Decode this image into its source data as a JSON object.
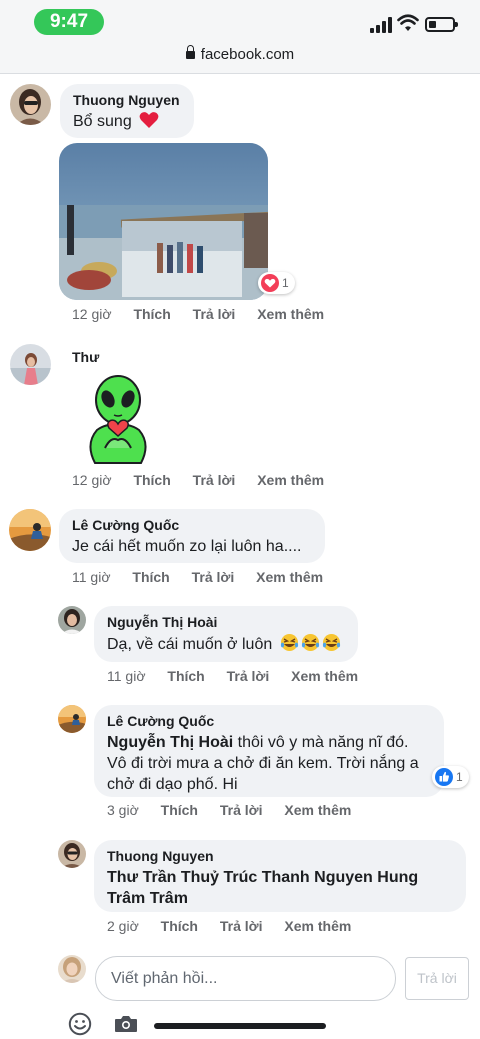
{
  "status": {
    "time": "9:47"
  },
  "browser": {
    "url": "facebook.com"
  },
  "comments": [
    {
      "author": "Thuong Nguyen",
      "text": "Bổ sung",
      "time": "12 giờ",
      "like": "Thích",
      "reply": "Trả lời",
      "more": "Xem thêm",
      "reaction_count": "1"
    },
    {
      "author": "Thư",
      "time": "12 giờ",
      "like": "Thích",
      "reply": "Trả lời",
      "more": "Xem thêm"
    },
    {
      "author": "Lê Cường Quốc",
      "text": "Je cái hết muốn zo lại luôn ha....",
      "time": "11 giờ",
      "like": "Thích",
      "reply": "Trả lời",
      "more": "Xem thêm"
    }
  ],
  "replies": [
    {
      "author": "Nguyễn Thị Hoài",
      "text": "Dạ, về cái muốn ở luôn",
      "time": "11 giờ",
      "like": "Thích",
      "reply": "Trả lời",
      "more": "Xem thêm"
    },
    {
      "author": "Lê Cường Quốc",
      "mention": "Nguyễn Thị Hoài",
      "text": " thôi vô y mà năng nĩ đó. Vô đi trời mưa a chở đi ăn kem. Trời nắng a chở đi dạo phố. Hi",
      "time": "3 giờ",
      "like": "Thích",
      "reply": "Trả lời",
      "more": "Xem thêm",
      "reaction_count": "1"
    },
    {
      "author": "Thuong Nguyen",
      "mention": "Thư Trần Thuỷ Trúc Thanh Nguyen Hung Trâm Trâm",
      "time": "2 giờ",
      "like": "Thích",
      "reply": "Trả lời",
      "more": "Xem thêm"
    }
  ],
  "composer": {
    "placeholder": "Viết phản hồi...",
    "send_label": "Trả lời"
  },
  "colors": {
    "like_blue": "#1877f2",
    "love_red": "#f33e58",
    "status_green": "#34c759"
  }
}
